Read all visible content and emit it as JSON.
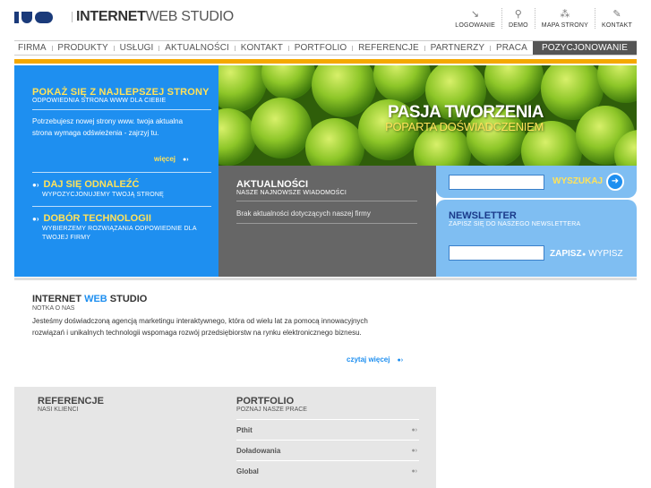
{
  "header": {
    "logo_mark": "IWS",
    "logo_strong": "INTERNET",
    "logo_rest": "WEB STUDIO",
    "toplinks": [
      {
        "label": "LOGOWANIE",
        "icon": "login-icon"
      },
      {
        "label": "DEMO",
        "icon": "demo-icon"
      },
      {
        "label": "MAPA STRONY",
        "icon": "sitemap-icon"
      },
      {
        "label": "KONTAKT",
        "icon": "contact-icon"
      }
    ]
  },
  "nav": {
    "items": [
      "FIRMA",
      "PRODUKTY",
      "USŁUGI",
      "AKTUALNOŚCI",
      "KONTAKT",
      "PORTFOLIO",
      "REFERENCJE",
      "PARTNERZY",
      "PRACA"
    ],
    "active": "POZYCJONOWANIE"
  },
  "left_panel": {
    "title": "POKAŻ SIĘ Z NAJLEPSZEJ STRONY",
    "subtitle": "ODPOWIEDNIA STRONA WWW DLA CIEBIE",
    "text": "Potrzebujesz nowej strony www. twoja aktualna strona wymaga odświeżenia - zajrzyj tu.",
    "more": "więcej",
    "items": [
      {
        "title": "DAJ SIĘ ODNALEŹĆ",
        "subtitle": "WYPOZYCJONUJEMY TWOJĄ STRONĘ"
      },
      {
        "title": "DOBÓR TECHNOLOGII",
        "subtitle": "WYBIERZEMY ROZWIĄZANIA ODPOWIEDNIE DLA TWOJEJ FIRMY"
      }
    ]
  },
  "hero": {
    "title": "PASJA TWORZENIA",
    "subtitle": "POPARTA DOŚWIADCZENIEM"
  },
  "news": {
    "title": "AKTUALNOŚCI",
    "subtitle": "NASZE NAJNOWSZE WIADOMOŚCI",
    "empty_text": "Brak aktualności dotyczących naszej firmy"
  },
  "search": {
    "button": "WYSZUKAJ",
    "value": ""
  },
  "newsletter": {
    "title": "NEWSLETTER",
    "subtitle": "ZAPISZ SIĘ DO NASZEGO NEWSLETTERA",
    "value": "",
    "subscribe": "ZAPISZ",
    "unsubscribe": "WYPISZ"
  },
  "about": {
    "title_a": "INTERNET",
    "title_b": "WEB",
    "title_c": "STUDIO",
    "subtitle": "NOTKA O NAS",
    "text": "Jesteśmy doświadczoną agencją marketingu interaktywnego, która od wielu lat za pomocą innowacyjnych rozwiązań i unikalnych technologii wspomaga rozwój przedsiębiorstw na rynku elektronicznego biznesu.",
    "more": "czytaj więcej"
  },
  "references": {
    "title": "REFERENCJE",
    "subtitle": "NASI KLIENCI"
  },
  "portfolio": {
    "title": "PORTFOLIO",
    "subtitle": "POZNAJ NASZE PRACE",
    "items": [
      "Pthit",
      "Doładowania",
      "Global"
    ]
  },
  "colors": {
    "brand_blue": "#1e8ff0",
    "accent_yellow": "#ffe25a",
    "orange_bar": "#f5a800",
    "news_gray": "#666666",
    "light_blue": "#7fbef2",
    "logo_navy": "#1a3a7a"
  }
}
